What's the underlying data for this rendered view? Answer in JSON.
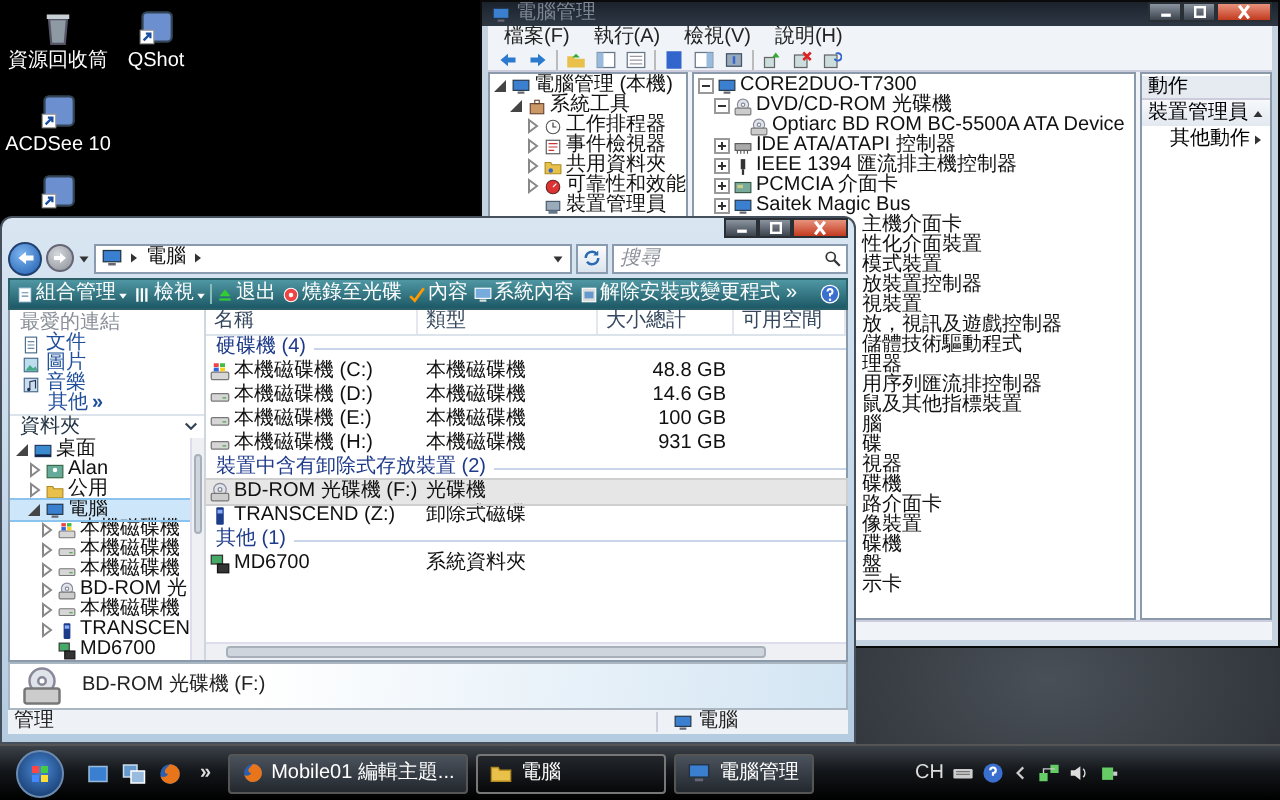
{
  "desktop": {
    "icons": [
      {
        "kind": "recycle-bin",
        "label": "資源回收筒"
      },
      {
        "kind": "app-shortcut",
        "label": "QShot"
      },
      {
        "kind": "app-shortcut",
        "label": "ACDSee 10"
      },
      {
        "kind": "app-shortcut"
      }
    ]
  },
  "management_window": {
    "title": "電腦管理",
    "menu": [
      "檔案(F)",
      "執行(A)",
      "檢視(V)",
      "說明(H)"
    ],
    "tree": [
      {
        "label": "電腦管理 (本機)",
        "kind": "computer",
        "expanded": true,
        "children": [
          {
            "label": "系統工具",
            "kind": "tools",
            "expanded": true,
            "children": [
              {
                "label": "工作排程器",
                "kind": "clock",
                "expanded": false
              },
              {
                "label": "事件檢視器",
                "kind": "log",
                "expanded": false
              },
              {
                "label": "共用資料夾",
                "kind": "share",
                "expanded": false
              },
              {
                "label": "可靠性和效能",
                "kind": "perf",
                "expanded": false
              },
              {
                "label": "裝置管理員",
                "kind": "device"
              }
            ]
          }
        ]
      }
    ],
    "device_tree": [
      {
        "label": "CORE2DUO-T7300",
        "kind": "computer",
        "expanded": true,
        "children": [
          {
            "label": "DVD/CD-ROM 光碟機",
            "kind": "optical",
            "expanded": true,
            "children": [
              {
                "label": "Optiarc BD ROM BC-5500A ATA Device",
                "kind": "optical"
              }
            ]
          },
          {
            "label": "IDE ATA/ATAPI 控制器",
            "kind": "controller",
            "expanded": false
          },
          {
            "label": "IEEE 1394 匯流排主機控制器",
            "kind": "plug",
            "expanded": false
          },
          {
            "label": "PCMCIA 介面卡",
            "kind": "card",
            "expanded": false
          },
          {
            "label": "Saitek Magic Bus",
            "kind": "computer",
            "expanded": false
          }
        ]
      }
    ],
    "covered_rows": [
      "主機介面卡",
      "性化介面裝置",
      "模式裝置",
      "放裝置控制器",
      "視裝置",
      "放，視訊及遊戲控制器",
      "儲體技術驅動程式",
      "理器",
      "用序列匯流排控制器",
      "鼠及其他指標裝置",
      "腦",
      "碟",
      "視器",
      "碟機",
      "路介面卡",
      "像裝置",
      "碟機",
      "盤",
      "示卡"
    ],
    "actions": {
      "header": "動作",
      "items": [
        {
          "label": "裝置管理員",
          "kind": "section"
        },
        {
          "label": "其他動作",
          "kind": "submenu"
        }
      ]
    }
  },
  "explorer_window": {
    "breadcrumb": [
      "電腦"
    ],
    "search": {
      "placeholder": "搜尋"
    },
    "toolbar": [
      {
        "label": "組合管理",
        "kind": "organize",
        "dropdown": true
      },
      {
        "label": "檢視",
        "kind": "views",
        "dropdown": true
      },
      {
        "label": "退出",
        "kind": "eject",
        "dropdown": false
      },
      {
        "label": "燒錄至光碟",
        "kind": "burn",
        "dropdown": false
      },
      {
        "label": "內容",
        "kind": "properties",
        "dropdown": false
      },
      {
        "label": "系統內容",
        "kind": "system",
        "dropdown": false
      },
      {
        "label": "解除安裝或變更程式",
        "kind": "uninstall",
        "dropdown": false
      }
    ],
    "toolbar_more": "»",
    "favorites": {
      "header": "最愛的連結",
      "items": [
        {
          "label": "文件",
          "kind": "documents"
        },
        {
          "label": "圖片",
          "kind": "pictures"
        },
        {
          "label": "音樂",
          "kind": "music"
        }
      ],
      "more": "其他",
      "more_chevron": "»"
    },
    "folders": {
      "header": "資料夾",
      "tree": [
        {
          "label": "桌面",
          "kind": "desktop",
          "expanded": true,
          "selected": false,
          "children": [
            {
              "label": "Alan",
              "kind": "user",
              "expanded": false,
              "selected": false
            },
            {
              "label": "公用",
              "kind": "folder",
              "expanded": false,
              "selected": false
            },
            {
              "label": "電腦",
              "kind": "computer",
              "expanded": true,
              "selected": true,
              "children": [
                {
                  "label": "本機磁碟機",
                  "kind": "system-drive",
                  "expanded": false,
                  "selected": false
                },
                {
                  "label": "本機磁碟機",
                  "kind": "drive",
                  "expanded": false,
                  "selected": false
                },
                {
                  "label": "本機磁碟機",
                  "kind": "drive",
                  "expanded": false,
                  "selected": false
                },
                {
                  "label": "BD-ROM 光",
                  "kind": "optical",
                  "expanded": false,
                  "selected": false
                },
                {
                  "label": "本機磁碟機",
                  "kind": "drive",
                  "expanded": false,
                  "selected": false
                },
                {
                  "label": "TRANSCEN",
                  "kind": "usb",
                  "expanded": false,
                  "selected": false
                },
                {
                  "label": "MD6700",
                  "kind": "network-pc",
                  "selected": false
                }
              ]
            }
          ]
        }
      ]
    },
    "columns": [
      "名稱",
      "類型",
      "大小總計",
      "可用空間"
    ],
    "groups": [
      {
        "title": "硬碟機 (4)",
        "rows": [
          {
            "kind": "system-drive",
            "name": "本機磁碟機 (C:)",
            "type": "本機磁碟機",
            "size": "48.8 GB",
            "selected": false
          },
          {
            "kind": "drive",
            "name": "本機磁碟機 (D:)",
            "type": "本機磁碟機",
            "size": "14.6 GB",
            "selected": false
          },
          {
            "kind": "drive",
            "name": "本機磁碟機 (E:)",
            "type": "本機磁碟機",
            "size": "100 GB",
            "selected": false
          },
          {
            "kind": "drive",
            "name": "本機磁碟機 (H:)",
            "type": "本機磁碟機",
            "size": "931 GB",
            "selected": false
          }
        ]
      },
      {
        "title": "裝置中含有卸除式存放裝置 (2)",
        "rows": [
          {
            "kind": "optical",
            "name": "BD-ROM 光碟機 (F:)",
            "type": "光碟機",
            "selected": true
          },
          {
            "kind": "usb",
            "name": "TRANSCEND (Z:)",
            "type": "卸除式磁碟",
            "selected": false
          }
        ]
      },
      {
        "title": "其他 (1)",
        "rows": [
          {
            "kind": "network-pc",
            "name": "MD6700",
            "type": "系統資料夾",
            "selected": false
          }
        ]
      }
    ],
    "details": {
      "kind": "optical",
      "name": "BD-ROM 光碟機 (F:)"
    },
    "status_bar": {
      "left": "管理",
      "right": "電腦"
    }
  },
  "taskbar": {
    "quick_launch": [
      {
        "kind": "show-desktop"
      },
      {
        "kind": "switch-windows"
      },
      {
        "kind": "browser"
      }
    ],
    "more": "»",
    "tasks": [
      {
        "label": "Mobile01 編輯主題...",
        "kind": "browser",
        "selected": false
      },
      {
        "label": "電腦",
        "kind": "folder",
        "selected": true
      },
      {
        "label": "電腦管理",
        "kind": "computer",
        "selected": false
      }
    ],
    "tray": {
      "language": "CH"
    }
  }
}
